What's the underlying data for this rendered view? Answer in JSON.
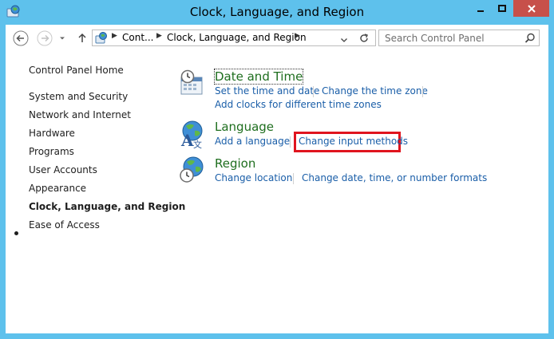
{
  "window": {
    "title": "Clock, Language, and Region",
    "minimize_label": "Minimize",
    "maximize_label": "Maximize",
    "close_label": "Close"
  },
  "address_bar": {
    "crumbs": [
      "Cont...",
      "Clock, Language, and Region"
    ]
  },
  "search": {
    "placeholder": "Search Control Panel"
  },
  "sidebar": {
    "items": [
      {
        "label": "Control Panel Home"
      },
      {
        "label": "System and Security"
      },
      {
        "label": "Network and Internet"
      },
      {
        "label": "Hardware"
      },
      {
        "label": "Programs"
      },
      {
        "label": "User Accounts"
      },
      {
        "label": "Appearance"
      },
      {
        "label": "Clock, Language, and Region",
        "active": true
      },
      {
        "label": "Ease of Access"
      }
    ]
  },
  "categories": [
    {
      "title": "Date and Time",
      "icon": "calendar-clock-icon",
      "links": [
        "Set the time and date",
        "Change the time zone",
        "Add clocks for different time zones"
      ]
    },
    {
      "title": "Language",
      "icon": "language-globe-icon",
      "links": [
        "Add a language",
        "Change input methods"
      ]
    },
    {
      "title": "Region",
      "icon": "region-globe-clock-icon",
      "links": [
        "Change location",
        "Change date, time, or number formats"
      ]
    }
  ],
  "colors": {
    "frame": "#5ec1ec",
    "close_button": "#c7504a",
    "category_title": "#1e6e1e",
    "link": "#1a5ea8",
    "highlight_box": "#e0141e"
  }
}
